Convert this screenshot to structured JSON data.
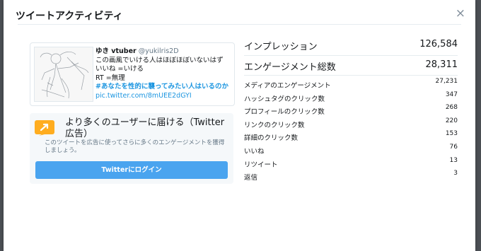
{
  "dialog": {
    "title": "ツイートアクティビティ",
    "close_symbol": "×"
  },
  "tweet": {
    "name": "ゆき vtuber",
    "handle": "@yukilris2D",
    "lines": [
      "この画風でいける人はほぼほぼいないはず",
      "いいね =いける",
      "RT =無理"
    ],
    "hashtag": "#あなたを性的に襲ってみたい人はいるのか",
    "link": "pic.twitter.com/8mUEE2dGYI"
  },
  "promo": {
    "title": "より多くのユーザーに届ける（Twitter広告）",
    "description": "このツイートを広告に使ってさらに多くのエンゲージメントを獲得しましょう。",
    "button_label": "Twitterにログイン"
  },
  "stats": {
    "impressions": {
      "label": "インプレッション",
      "value": "126,584"
    },
    "engagements": {
      "label": "エンゲージメント総数",
      "value": "28,311"
    },
    "rows": [
      {
        "label": "メディアのエンゲージメント",
        "value": "27,231"
      },
      {
        "label": "ハッシュタグのクリック数",
        "value": "347"
      },
      {
        "label": "プロフィールのクリック数",
        "value": "268"
      },
      {
        "label": "リンクのクリック数",
        "value": "220"
      },
      {
        "label": "詳細のクリック数",
        "value": "153"
      },
      {
        "label": "いいね",
        "value": "76"
      },
      {
        "label": "リツイート",
        "value": "13"
      },
      {
        "label": "返信",
        "value": "3"
      }
    ]
  },
  "colors": {
    "accent": "#4aa4ef",
    "link": "#1b95e0",
    "promo_icon": "#ffad1f"
  },
  "icons": {
    "close": "close-icon",
    "promo": "megaphone-icon"
  }
}
